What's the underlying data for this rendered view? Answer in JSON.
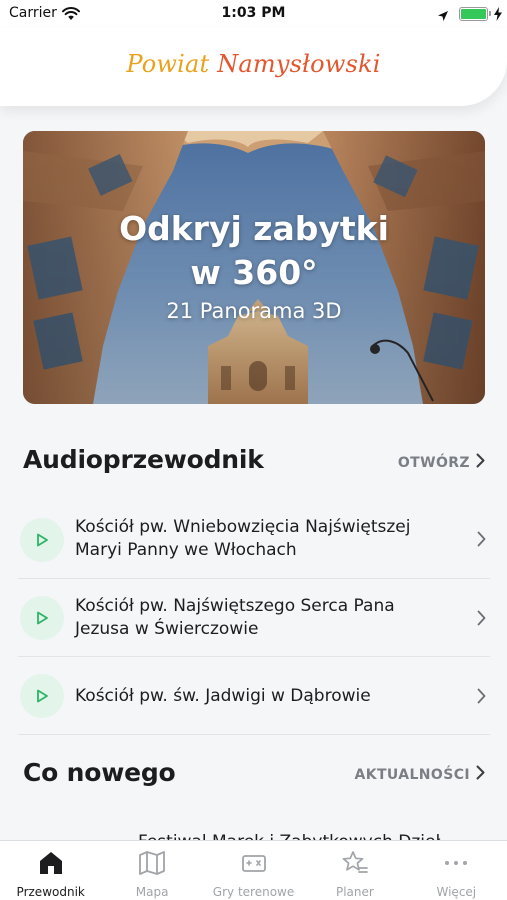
{
  "status_bar": {
    "carrier": "Carrier",
    "time": "1:03 PM"
  },
  "header": {
    "brand_part1": "Powiat ",
    "brand_part2": "Namysłowski",
    "brand_colors": [
      "#e9a21b",
      "#e4572e"
    ]
  },
  "hero": {
    "title_line1": "Odkryj zabytki",
    "title_line2": "w 360°",
    "subtitle": "21 Panorama 3D"
  },
  "audio_section": {
    "title": "Audioprzewodnik",
    "link_label": "OTWÓRZ",
    "items": [
      {
        "line1": "Kościół pw. Wniebowzięcia Najświętszej",
        "line2": "Maryi Panny we Włochach"
      },
      {
        "line1": "Kościół pw. Najświętszego Serca Pana",
        "line2": "Jezusa w Świerczowie"
      },
      {
        "line1": "Kościół pw. św. Jadwigi w Dąbrowie",
        "line2": ""
      }
    ]
  },
  "news_section": {
    "title": "Co nowego",
    "link_label": "AKTUALNOŚCI",
    "peek_text": "Festiwal Marek i Zabytkowych Dzieł"
  },
  "tab_bar": {
    "active_color": "#1d1d1f",
    "inactive_color": "#a1a4a8",
    "tabs": [
      {
        "label": "Przewodnik",
        "icon": "home-icon"
      },
      {
        "label": "Mapa",
        "icon": "map-icon"
      },
      {
        "label": "Gry terenowe",
        "icon": "game-ticket-icon"
      },
      {
        "label": "Planer",
        "icon": "star-list-icon"
      },
      {
        "label": "Więcej",
        "icon": "more-dots-icon"
      }
    ]
  },
  "colors": {
    "play_bg": "#e3f4ea",
    "play_icon": "#2fb36a",
    "link_gray": "#7b7f85"
  }
}
